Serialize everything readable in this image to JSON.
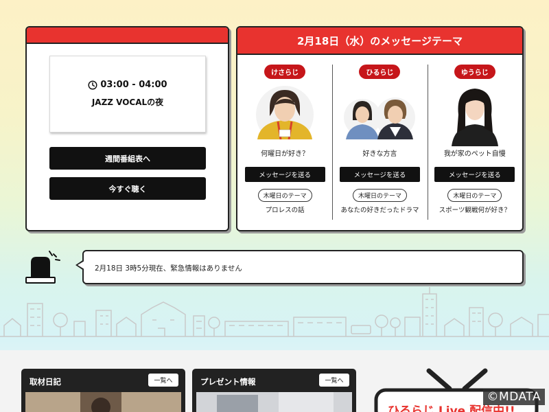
{
  "program": {
    "time": "03:00 - 04:00",
    "title": "JAZZ VOCALの夜",
    "weekly_button": "週間番組表へ",
    "listen_button": "今すぐ聴く"
  },
  "theme": {
    "header": "2月18日（水）のメッセージテーマ",
    "columns": [
      {
        "program": "けさらじ",
        "question": "何曜日が好き？",
        "button": "メッセージを送る",
        "thursday_label": "木曜日のテーマ",
        "thursday_topic": "プロレスの話"
      },
      {
        "program": "ひるらじ",
        "question": "好きな方言",
        "button": "メッセージを送る",
        "thursday_label": "木曜日のテーマ",
        "thursday_topic": "あなたの好きだったドラマ"
      },
      {
        "program": "ゆうらじ",
        "question": "我が家のペット自慢",
        "button": "メッセージを送る",
        "thursday_label": "木曜日のテーマ",
        "thursday_topic": "スポーツ観戦何が好き？"
      }
    ]
  },
  "emergency": {
    "text": "2月18日 3時5分現在、緊急情報はありません"
  },
  "cards": [
    {
      "title": "取材日記",
      "button": "一覧へ"
    },
    {
      "title": "プレゼント情報",
      "button": "一覧へ"
    }
  ],
  "tv_promo": {
    "text": "ひるらじ Live 配信中!!"
  },
  "watermark": "©MDATA",
  "colors": {
    "accent_red": "#e8332f",
    "pill_red": "#c6161a",
    "dark": "#111111"
  }
}
